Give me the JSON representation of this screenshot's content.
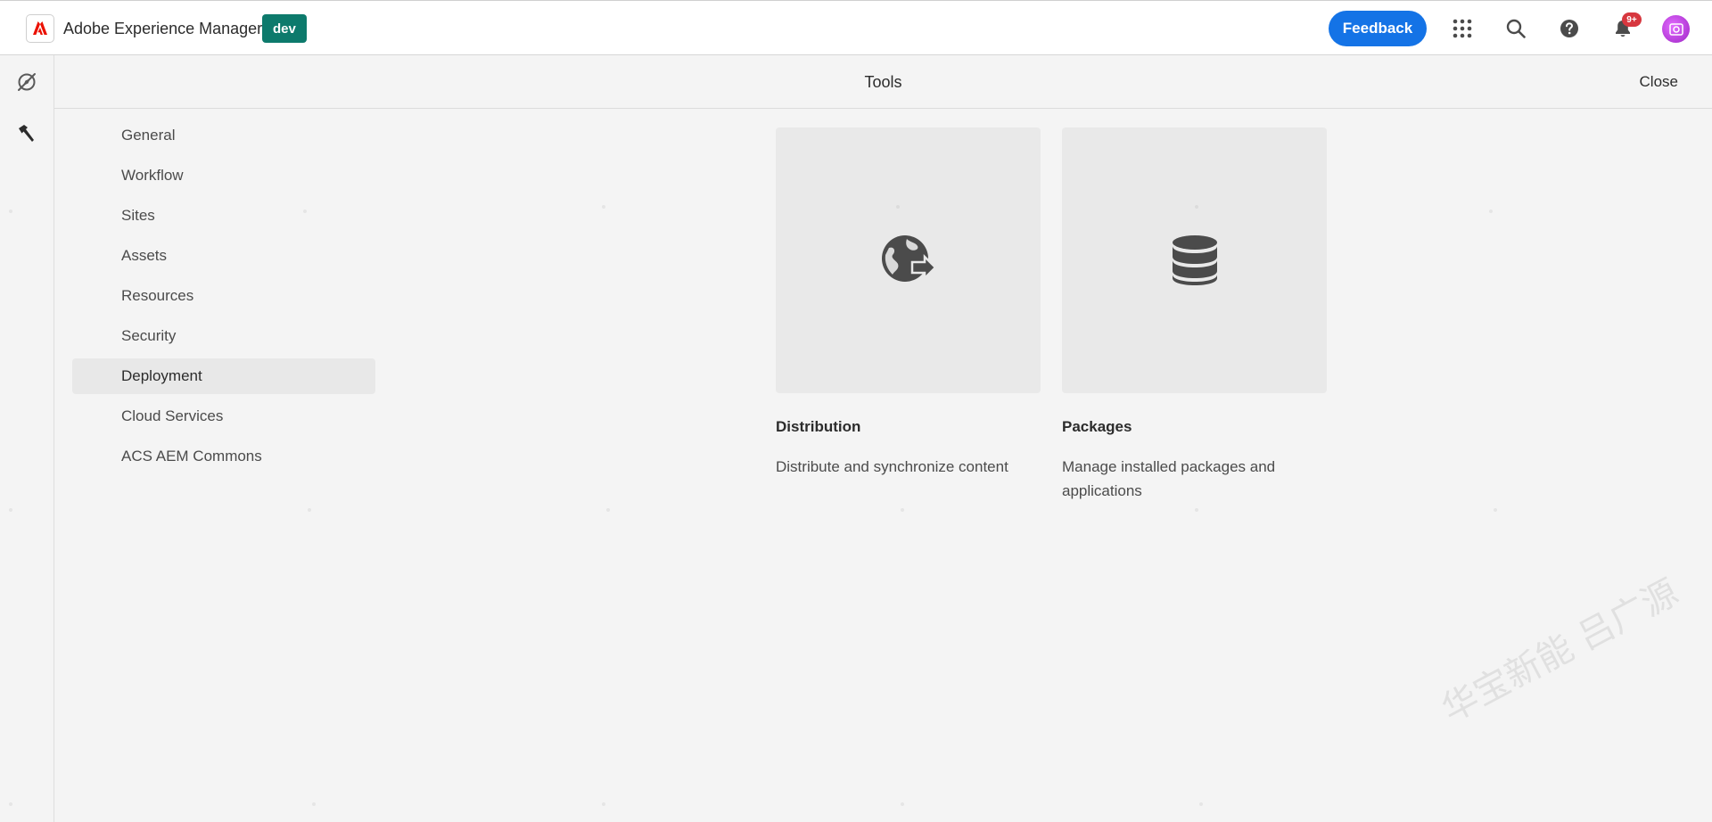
{
  "header": {
    "app_name": "Adobe Experience Manager",
    "env_badge": "dev",
    "feedback_label": "Feedback",
    "notification_count": "9+",
    "brand_color": "#1473e6",
    "env_color": "#0d7a6c"
  },
  "icons": {
    "logo": "adobe-logo-icon",
    "apps": "grid-apps-icon",
    "search": "search-icon",
    "help": "help-icon",
    "notifications": "bell-icon",
    "avatar": "user-avatar",
    "rail_navigation": "compass-icon",
    "rail_tools": "hammer-icon",
    "distribution": "globe-share-icon",
    "packages": "database-icon"
  },
  "titlebar": {
    "title": "Tools",
    "close_label": "Close"
  },
  "nav": {
    "items": [
      {
        "label": "General"
      },
      {
        "label": "Workflow"
      },
      {
        "label": "Sites"
      },
      {
        "label": "Assets"
      },
      {
        "label": "Resources"
      },
      {
        "label": "Security"
      },
      {
        "label": "Deployment",
        "selected": true
      },
      {
        "label": "Cloud Services"
      },
      {
        "label": "ACS AEM Commons"
      }
    ]
  },
  "cards": [
    {
      "title": "Distribution",
      "description": "Distribute and synchronize content"
    },
    {
      "title": "Packages",
      "description": "Manage installed packages and applications"
    }
  ],
  "watermark": "华宝新能 吕广源"
}
